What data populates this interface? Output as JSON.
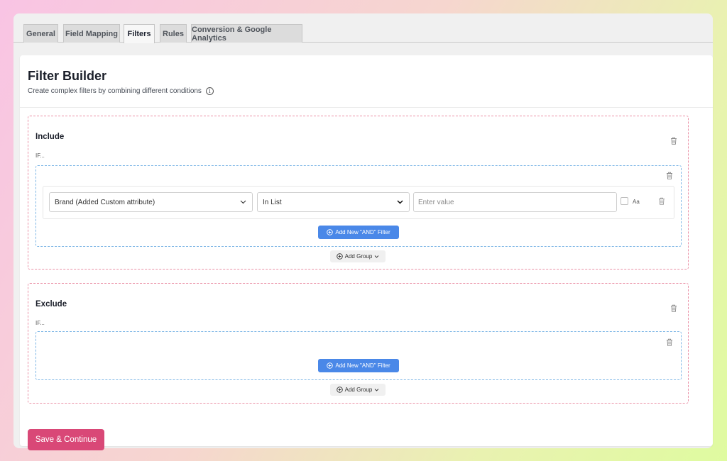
{
  "tabs": [
    {
      "label": "General"
    },
    {
      "label": "Field Mapping"
    },
    {
      "label": "Filters"
    },
    {
      "label": "Rules"
    },
    {
      "label": "Conversion & Google Analytics"
    }
  ],
  "active_tab": "Filters",
  "page": {
    "title": "Filter Builder",
    "subtitle": "Create complex filters by combining different conditions",
    "info_icon": "info-icon"
  },
  "include": {
    "title": "Include",
    "if_label": "IF...",
    "condition": {
      "attribute": "Brand (Added Custom attribute)",
      "operator": "In List",
      "value_placeholder": "Enter value",
      "case_label": "Aa"
    },
    "add_filter_label": "Add New \"AND\" Filter",
    "add_group_label": "Add Group"
  },
  "exclude": {
    "title": "Exclude",
    "if_label": "IF...",
    "add_filter_label": "Add New \"AND\" Filter",
    "add_group_label": "Add Group"
  },
  "save_label": "Save & Continue",
  "colors": {
    "primary_blue": "#4a88e8",
    "save_pink": "#d94877",
    "section_border": "#ea8fa5",
    "group_border": "#7db6e6"
  }
}
